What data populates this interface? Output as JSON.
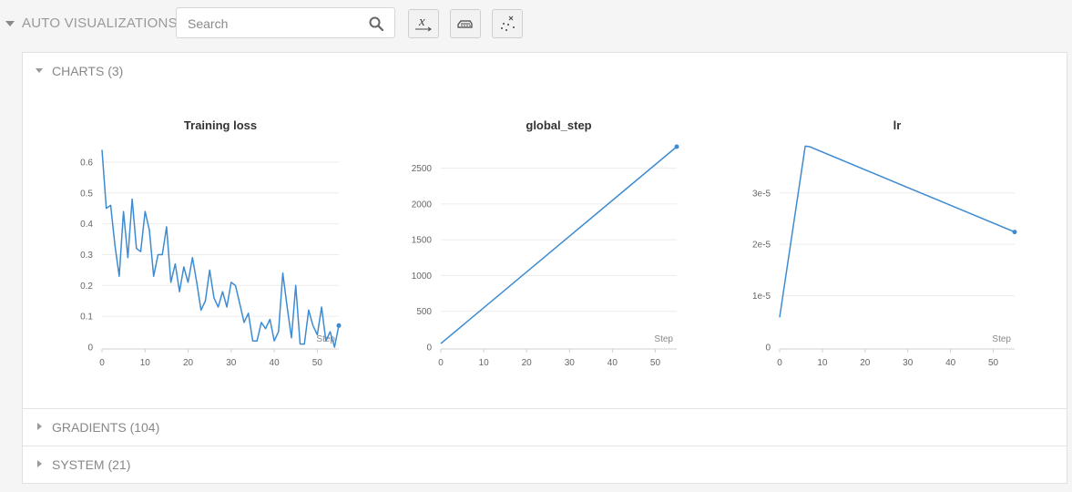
{
  "topbar": {
    "title": "AUTO VISUALIZATIONS",
    "search_placeholder": "Search",
    "tools": [
      {
        "icon": "x-axis-icon"
      },
      {
        "icon": "smoothing-icon"
      },
      {
        "icon": "outliers-icon"
      }
    ]
  },
  "groups": {
    "charts": {
      "label": "CHARTS (3)",
      "expanded": true
    },
    "gradients": {
      "label": "GRADIENTS (104)",
      "expanded": false
    },
    "system": {
      "label": "SYSTEM (21)",
      "expanded": false
    }
  },
  "colors": {
    "series": "#3d8bd2",
    "grid": "#ececec",
    "axis": "#cfcfcf"
  },
  "chart_data": [
    {
      "type": "line",
      "title": "Training loss",
      "xlabel": "Step",
      "ylabel": "",
      "xlim": [
        0,
        55
      ],
      "ylim": [
        0,
        0.65
      ],
      "xticks": [
        0,
        10,
        20,
        30,
        40,
        50
      ],
      "yticks": [
        0,
        0.1,
        0.2,
        0.3,
        0.4,
        0.5,
        0.6
      ],
      "ytick_labels": [
        "0",
        "0.1",
        "0.2",
        "0.3",
        "0.4",
        "0.5",
        "0.6"
      ],
      "grid": true,
      "series": [
        {
          "x": [
            0,
            1,
            2,
            3,
            4,
            5,
            6,
            7,
            8,
            9,
            10,
            11,
            12,
            13,
            14,
            15,
            16,
            17,
            18,
            19,
            20,
            21,
            22,
            23,
            24,
            25,
            26,
            27,
            28,
            29,
            30,
            31,
            32,
            33,
            34,
            35,
            36,
            37,
            38,
            39,
            40,
            41,
            42,
            43,
            44,
            45,
            46,
            47,
            48,
            49,
            50,
            51,
            52,
            53,
            54,
            55
          ],
          "y": [
            0.64,
            0.45,
            0.46,
            0.33,
            0.23,
            0.44,
            0.29,
            0.48,
            0.32,
            0.31,
            0.44,
            0.38,
            0.23,
            0.3,
            0.3,
            0.39,
            0.21,
            0.27,
            0.18,
            0.26,
            0.21,
            0.29,
            0.21,
            0.12,
            0.15,
            0.25,
            0.16,
            0.13,
            0.18,
            0.13,
            0.21,
            0.2,
            0.14,
            0.08,
            0.11,
            0.02,
            0.02,
            0.08,
            0.06,
            0.09,
            0.02,
            0.05,
            0.24,
            0.13,
            0.03,
            0.2,
            0.01,
            0.01,
            0.12,
            0.07,
            0.04,
            0.13,
            0.02,
            0.05,
            0.0,
            0.07
          ]
        }
      ]
    },
    {
      "type": "line",
      "title": "global_step",
      "xlabel": "Step",
      "ylabel": "",
      "xlim": [
        0,
        55
      ],
      "ylim": [
        0,
        2800
      ],
      "xticks": [
        0,
        10,
        20,
        30,
        40,
        50
      ],
      "yticks": [
        0,
        500,
        1000,
        1500,
        2000,
        2500
      ],
      "ytick_labels": [
        "0",
        "500",
        "1000",
        "1500",
        "2000",
        "2500"
      ],
      "grid": true,
      "series": [
        {
          "x": [
            0,
            55
          ],
          "y": [
            50,
            2800
          ]
        }
      ]
    },
    {
      "type": "line",
      "title": "lr",
      "xlabel": "Step",
      "ylabel": "",
      "xlim": [
        0,
        55
      ],
      "ylim": [
        0,
        3.9e-05
      ],
      "xticks": [
        0,
        10,
        20,
        30,
        40,
        50
      ],
      "yticks": [
        0,
        1e-05,
        2e-05,
        3e-05
      ],
      "ytick_labels": [
        "0",
        "1e-5",
        "2e-5",
        "3e-5"
      ],
      "grid": true,
      "series": [
        {
          "x": [
            0,
            6,
            7,
            55
          ],
          "y": [
            5.8e-06,
            3.91e-05,
            3.9e-05,
            2.24e-05
          ]
        }
      ]
    }
  ]
}
